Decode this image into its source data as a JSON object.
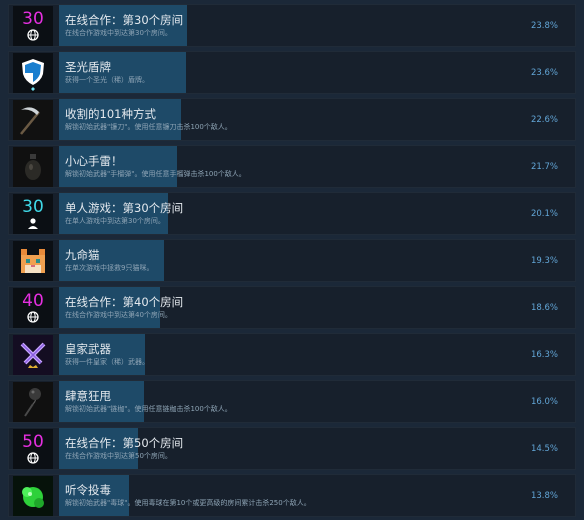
{
  "achievements": [
    {
      "title": "在线合作：第30个房间",
      "description": "在线合作游戏中到达第30个房间。",
      "percent": "23.8%",
      "progress": 0.238,
      "icon": "room-30-online-icon"
    },
    {
      "title": "圣光盾牌",
      "description": "获得一个圣光（稀）盾牌。",
      "percent": "23.6%",
      "progress": 0.236,
      "icon": "holy-shield-icon"
    },
    {
      "title": "收割的101种方式",
      "description": "解锁初始武器\"镰刀\"。使用任意镰刀击杀100个敌人。",
      "percent": "22.6%",
      "progress": 0.226,
      "icon": "scythe-icon"
    },
    {
      "title": "小心手雷！",
      "description": "解锁初始武器\"手榴弹\"。使用任意手榴弹击杀100个敌人。",
      "percent": "21.7%",
      "progress": 0.217,
      "icon": "grenade-icon"
    },
    {
      "title": "单人游戏：第30个房间",
      "description": "在单人游戏中到达第30个房间。",
      "percent": "20.1%",
      "progress": 0.201,
      "icon": "room-30-solo-icon"
    },
    {
      "title": "九命猫",
      "description": "在单次游戏中拯救9只猫咪。",
      "percent": "19.3%",
      "progress": 0.193,
      "icon": "pixel-cat-icon"
    },
    {
      "title": "在线合作：第40个房间",
      "description": "在线合作游戏中到达第40个房间。",
      "percent": "18.6%",
      "progress": 0.186,
      "icon": "room-40-online-icon"
    },
    {
      "title": "皇家武器",
      "description": "获得一件皇家（稀）武器。",
      "percent": "16.3%",
      "progress": 0.163,
      "icon": "royal-weapon-icon"
    },
    {
      "title": "肆意狂甩",
      "description": "解锁初始武器\"链枷\"。使用任意链枷击杀100个敌人。",
      "percent": "16.0%",
      "progress": 0.16,
      "icon": "flail-icon"
    },
    {
      "title": "在线合作：第50个房间",
      "description": "在线合作游戏中到达第50个房间。",
      "percent": "14.5%",
      "progress": 0.145,
      "icon": "room-50-online-icon"
    },
    {
      "title": "听令投毒",
      "description": "解锁初始武器\"毒球\"。使用毒球在第10个或更高级的房间累计击杀250个敌人。",
      "percent": "13.8%",
      "progress": 0.138,
      "icon": "poison-orb-icon"
    }
  ],
  "icon_texts": {
    "n30": "30",
    "n40": "40",
    "n50": "50"
  },
  "colors": {
    "background": "#1b2838",
    "row": "#17202c",
    "progress_bar": "#1e4a68",
    "percent_text": "#62a5d6",
    "number_magenta": "#e52fe0",
    "number_cyan": "#3fd9e8"
  }
}
